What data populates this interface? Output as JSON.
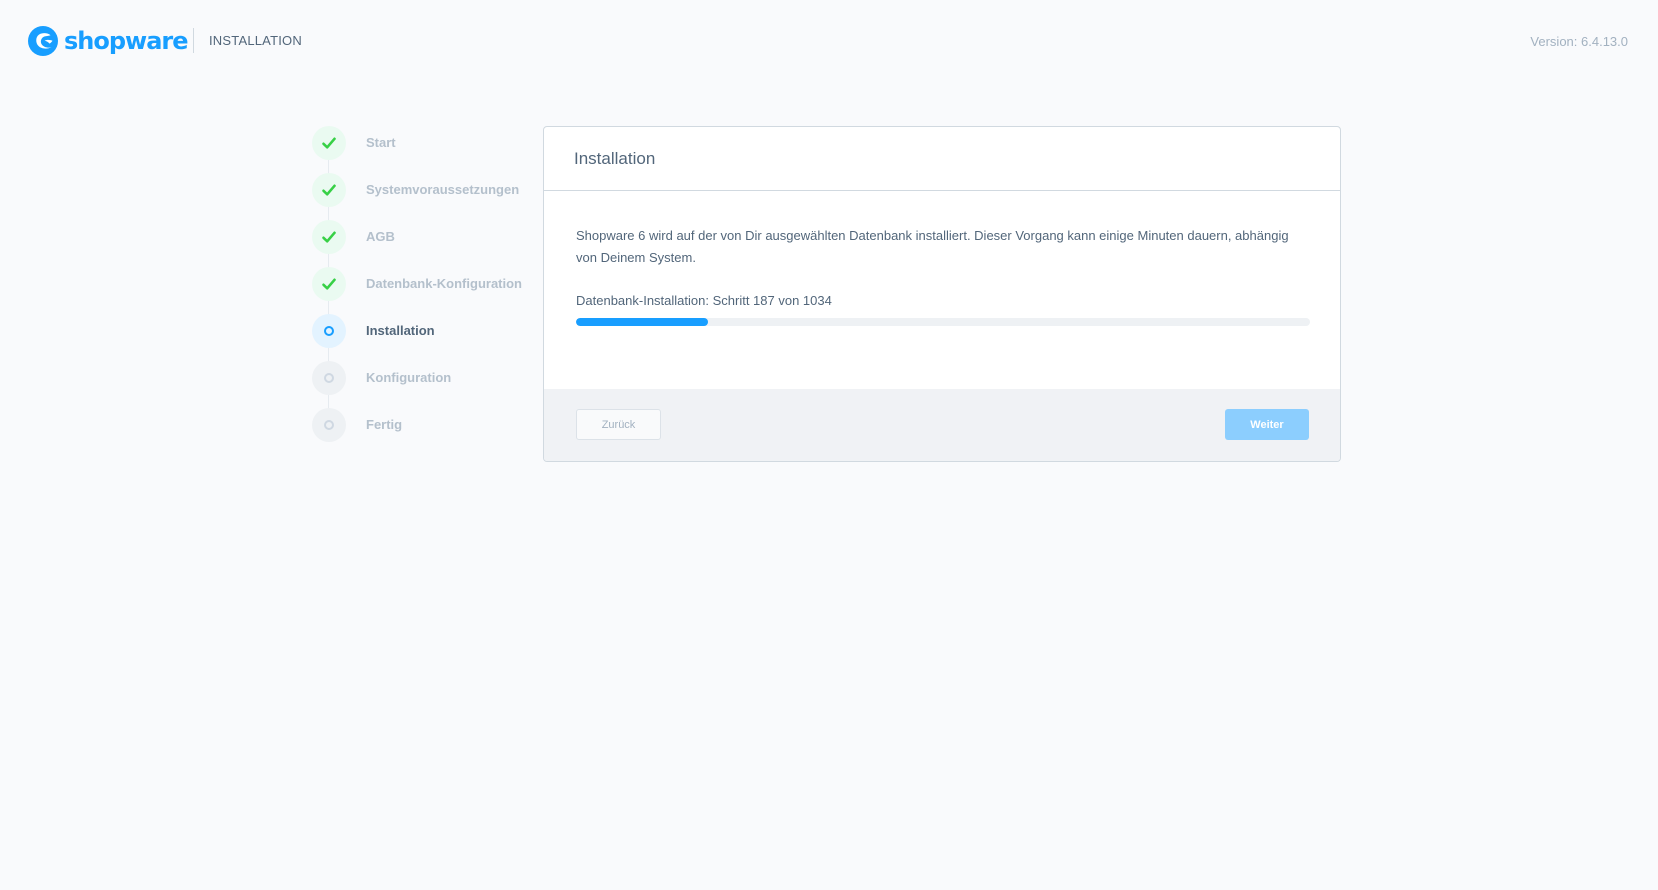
{
  "header": {
    "logo_text": "shopware",
    "title": "INSTALLATION",
    "version": "Version: 6.4.13.0"
  },
  "steps": [
    {
      "label": "Start",
      "state": "done",
      "icon": "check-icon"
    },
    {
      "label": "Systemvoraussetzungen",
      "state": "done",
      "icon": "check-icon"
    },
    {
      "label": "AGB",
      "state": "done",
      "icon": "check-icon"
    },
    {
      "label": "Datenbank-Konfiguration",
      "state": "done",
      "icon": "check-icon"
    },
    {
      "label": "Installation",
      "state": "active",
      "icon": "ring-icon"
    },
    {
      "label": "Konfiguration",
      "state": "pending",
      "icon": "ring-icon"
    },
    {
      "label": "Fertig",
      "state": "pending",
      "icon": "ring-icon"
    }
  ],
  "card": {
    "title": "Installation",
    "description": "Shopware 6 wird auf der von Dir ausgewählten Datenbank installiert. Dieser Vorgang kann einige Minuten dauern, abhängig von Deinem System.",
    "progress_label": "Datenbank-Installation: Schritt 187 von 1034",
    "progress_fraction": 0.18
  },
  "footer": {
    "back_label": "Zurück",
    "next_label": "Weiter"
  },
  "colors": {
    "brand": "#189eff",
    "check": "#37d046",
    "background": "#f9fafc"
  }
}
